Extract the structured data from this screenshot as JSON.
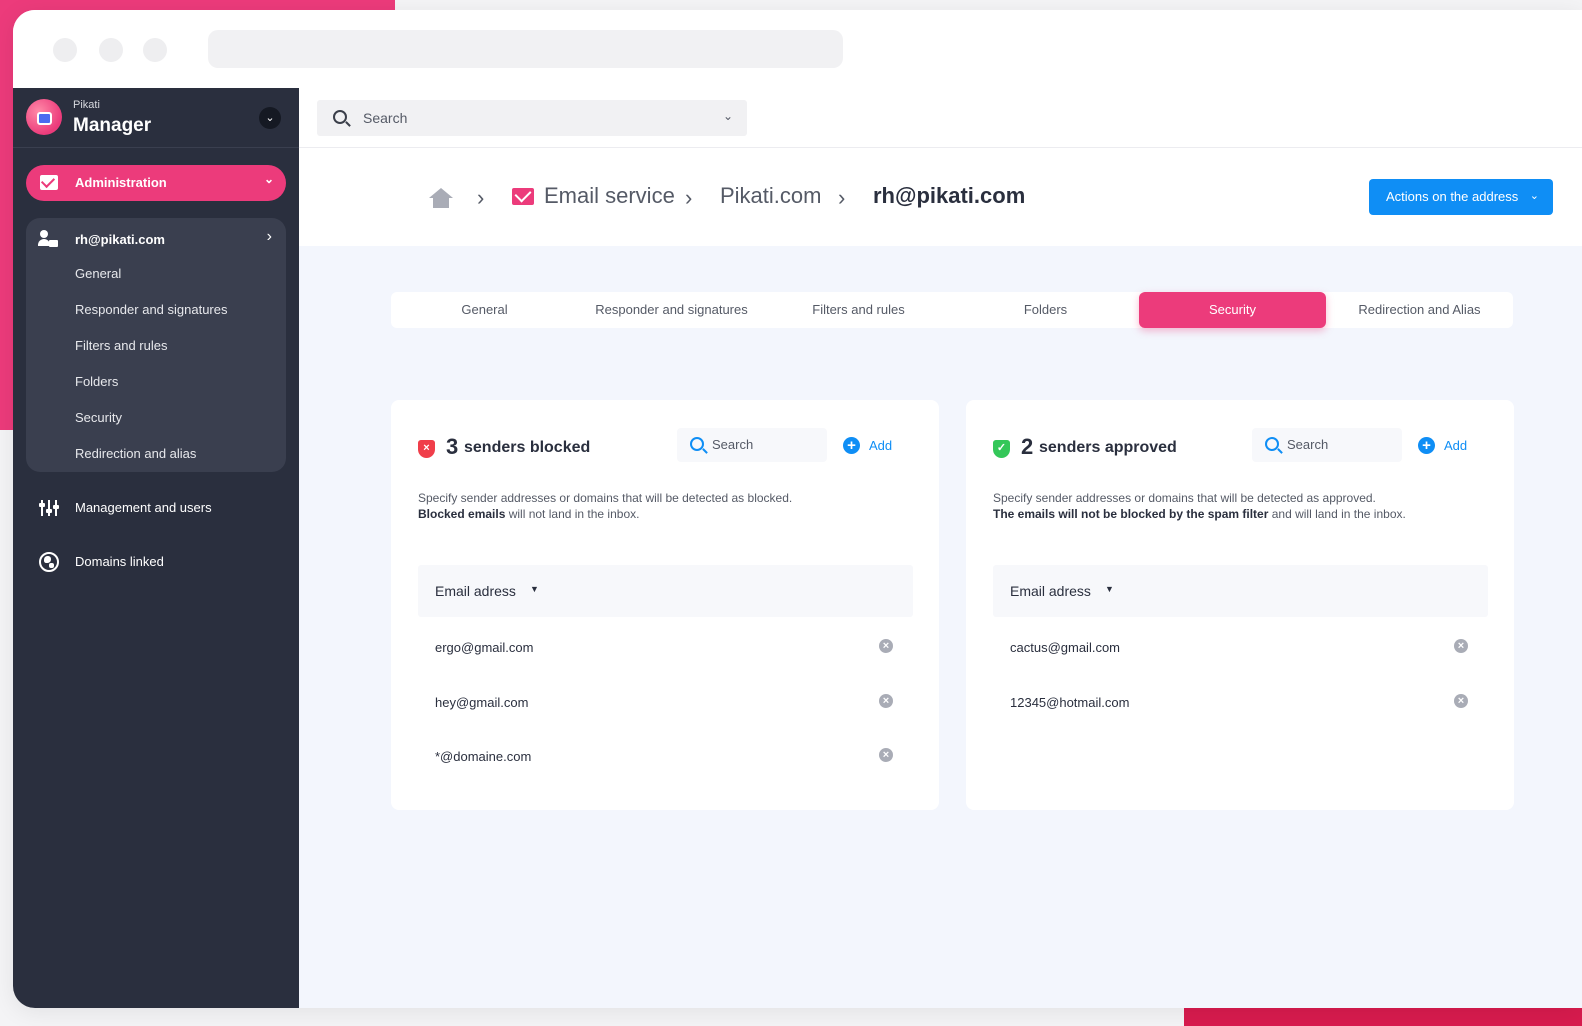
{
  "brand": {
    "small": "Pikati",
    "big": "Manager"
  },
  "sidebar": {
    "admin_label": "Administration",
    "account": {
      "label": "rh@pikati.com"
    },
    "sub_items": [
      {
        "label": "General"
      },
      {
        "label": "Responder and signatures"
      },
      {
        "label": "Filters and rules"
      },
      {
        "label": "Folders"
      },
      {
        "label": "Security"
      },
      {
        "label": "Redirection and alias"
      }
    ],
    "nav": [
      {
        "label": "Management and users",
        "icon": "sliders-icon"
      },
      {
        "label": "Domains linked",
        "icon": "globe-icon"
      }
    ]
  },
  "top_search": {
    "label": "Search"
  },
  "breadcrumb": {
    "items": [
      "Email service",
      "Pikati.com"
    ],
    "current": "rh@pikati.com"
  },
  "actions_button": "Actions on the address",
  "tabs": [
    {
      "label": "General",
      "active": false
    },
    {
      "label": "Responder and signatures",
      "active": false
    },
    {
      "label": "Filters and rules",
      "active": false
    },
    {
      "label": "Folders",
      "active": false
    },
    {
      "label": "Security",
      "active": true
    },
    {
      "label": "Redirection and Alias",
      "active": false
    }
  ],
  "blocked": {
    "count": "3",
    "title": "senders blocked",
    "search_label": "Search",
    "add_label": "Add",
    "desc_line1": "Specify sender addresses or domains that will be detected as blocked.",
    "desc_bold": "Blocked emails",
    "desc_rest": " will not land in the inbox.",
    "column": "Email adress",
    "rows": [
      "ergo@gmail.com",
      "hey@gmail.com",
      "*@domaine.com"
    ]
  },
  "approved": {
    "count": "2",
    "title": "senders approved",
    "search_label": "Search",
    "add_label": "Add",
    "desc_line1": "Specify sender addresses or domains that will be detected as approved.",
    "desc_bold": "The emails will not be blocked by the spam filter",
    "desc_rest": " and will land in the inbox.",
    "column": "Email adress",
    "rows": [
      "cactus@gmail.com",
      "12345@hotmail.com"
    ]
  },
  "colors": {
    "accent": "#ec3b7b",
    "primary": "#0f8ef5",
    "sidebar": "#2a2f3e",
    "blocked": "#f03e4a",
    "approved": "#34c759"
  }
}
